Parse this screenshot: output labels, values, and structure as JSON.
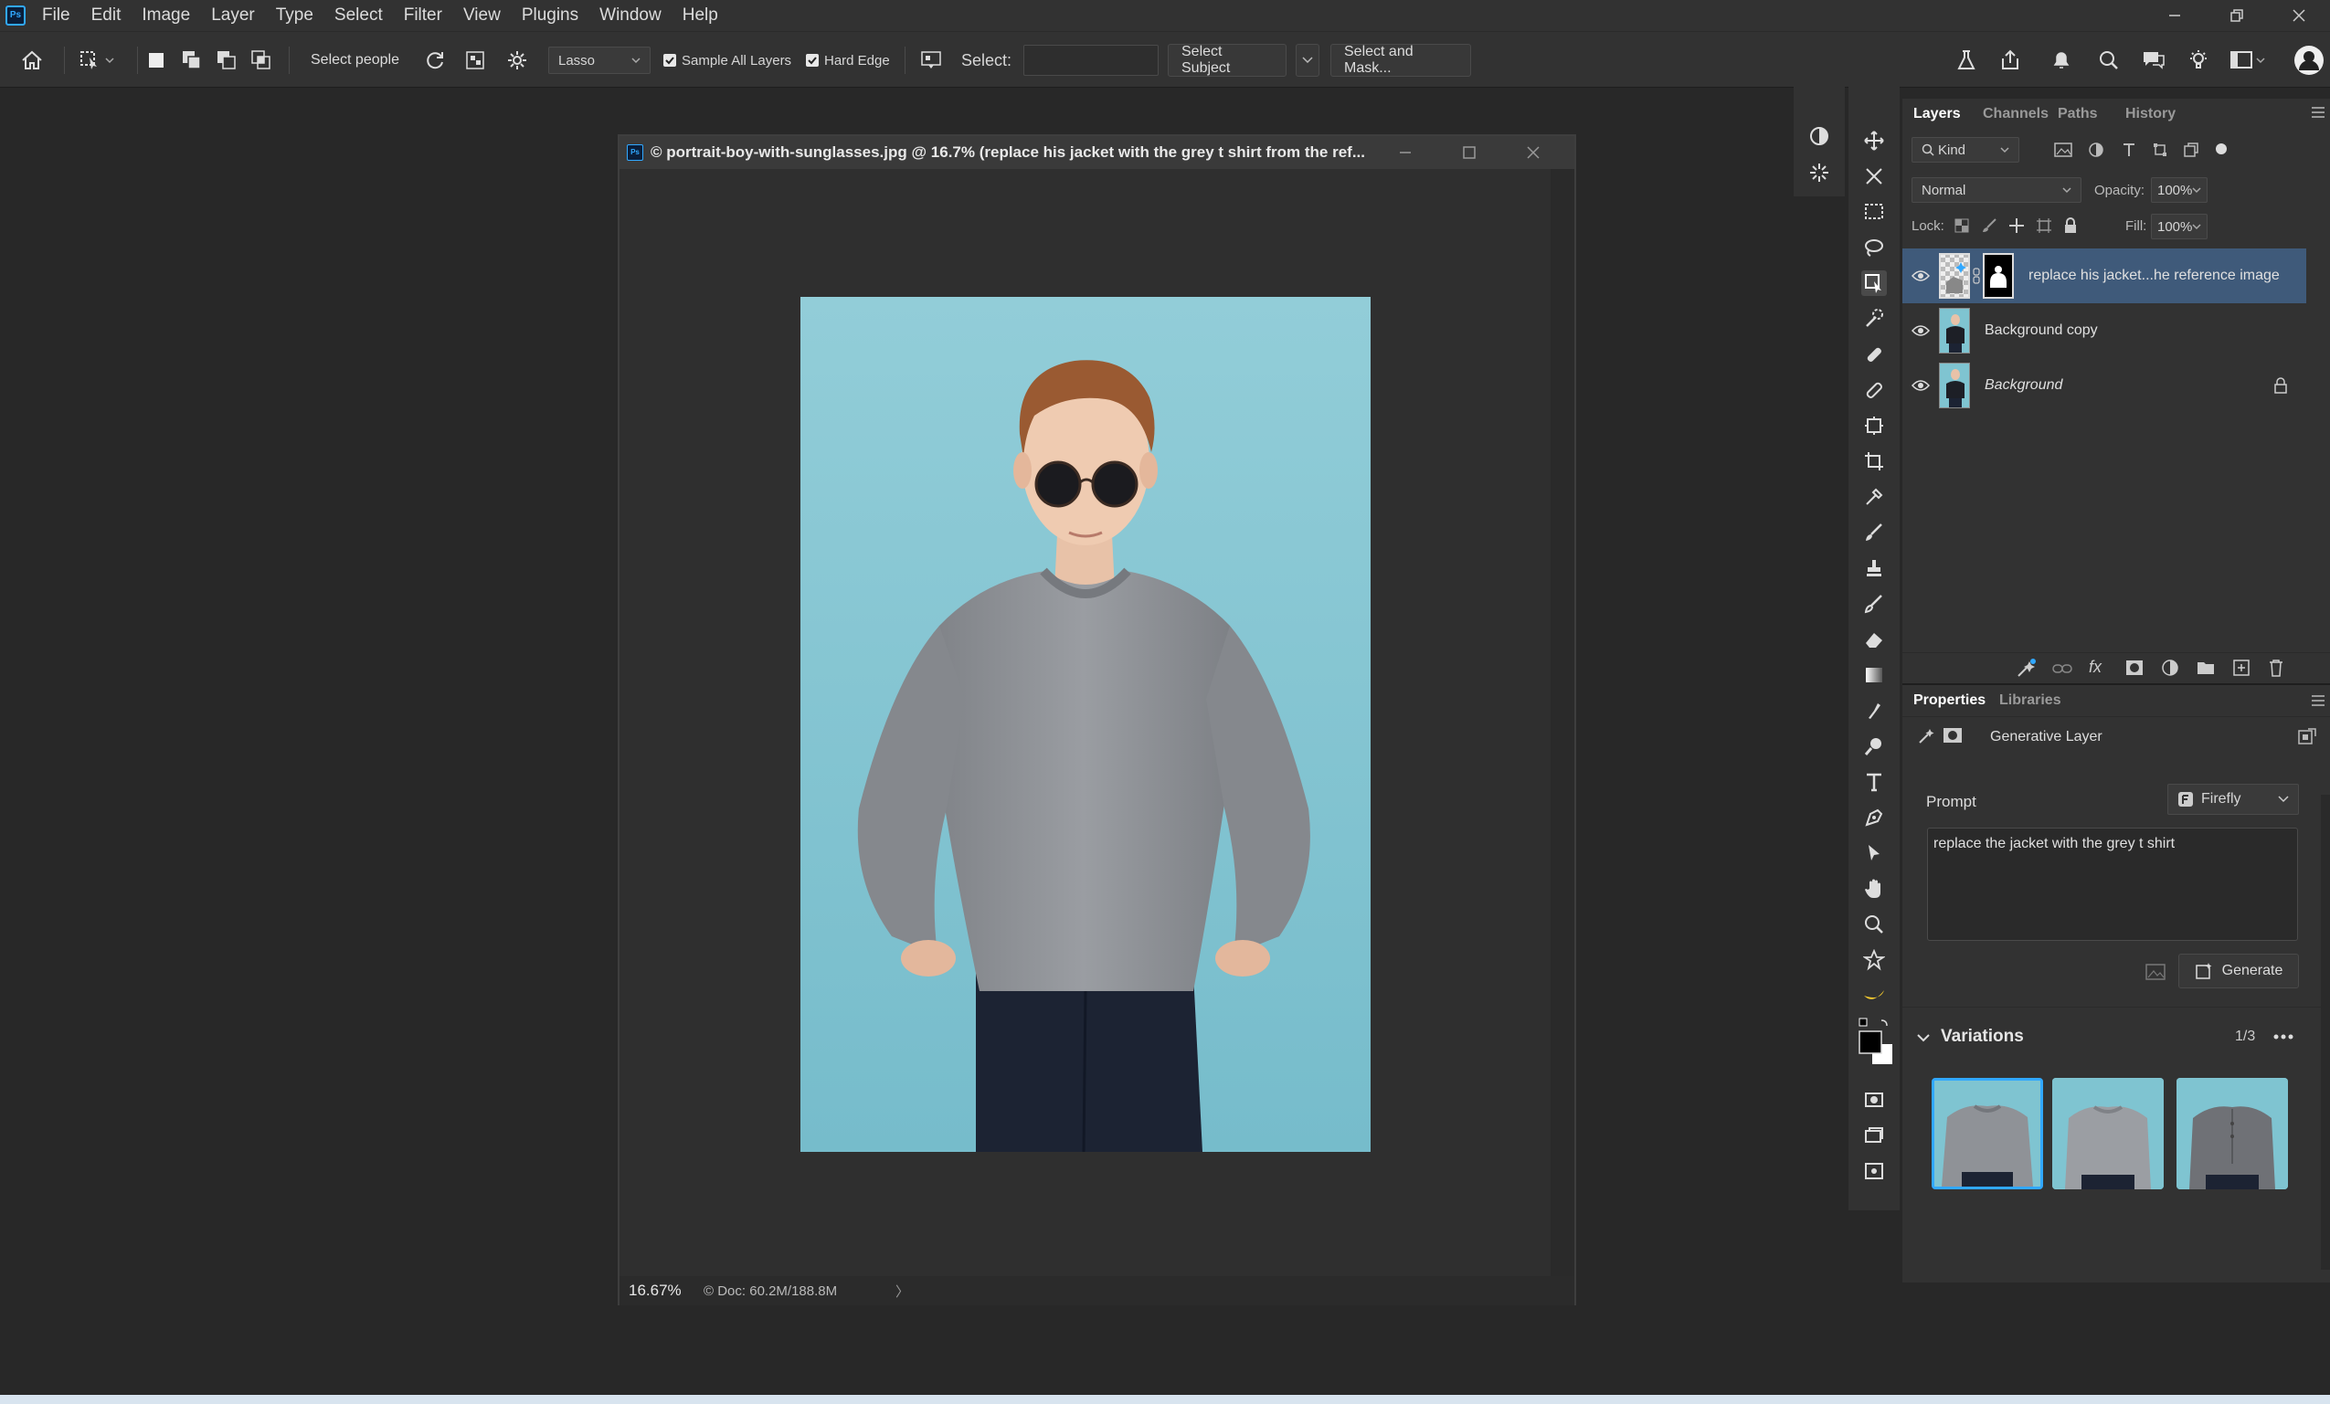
{
  "menu": {
    "items": [
      "File",
      "Edit",
      "Image",
      "Layer",
      "Type",
      "Select",
      "Filter",
      "View",
      "Plugins",
      "Window",
      "Help"
    ]
  },
  "options_bar": {
    "select_people": "Select people",
    "lasso": "Lasso",
    "sample_all_layers": "Sample All Layers",
    "hard_edge": "Hard Edge",
    "select_label": "Select:",
    "select_value": "",
    "select_subject": "Select Subject",
    "select_and_mask": "Select and Mask..."
  },
  "document": {
    "title": "© portrait-boy-with-sunglasses.jpg @ 16.7% (replace his jacket with the grey t shirt from the ref...",
    "zoom": "16.67%",
    "doc_info": "© Doc: 60.2M/188.8M"
  },
  "layers_panel": {
    "tabs": [
      "Layers",
      "Channels",
      "Paths",
      "History"
    ],
    "kind": "Kind",
    "blend_mode": "Normal",
    "opacity_label": "Opacity:",
    "opacity_value": "100%",
    "lock_label": "Lock:",
    "fill_label": "Fill:",
    "fill_value": "100%",
    "layers": [
      {
        "name": "replace his jacket...he reference image"
      },
      {
        "name": "Background copy"
      },
      {
        "name": "Background"
      }
    ]
  },
  "properties_panel": {
    "tabs": [
      "Properties",
      "Libraries"
    ],
    "layer_type": "Generative Layer",
    "prompt_label": "Prompt",
    "model": "Firefly",
    "prompt_text": "replace the jacket with the grey t shirt",
    "generate": "Generate",
    "variations_label": "Variations",
    "variations_count": "1/3"
  },
  "colors": {
    "accent": "#31a8ff",
    "selected_layer": "#3f5a7a",
    "canvas_bg": "#82c6d2",
    "shirt": "#8e9196"
  }
}
